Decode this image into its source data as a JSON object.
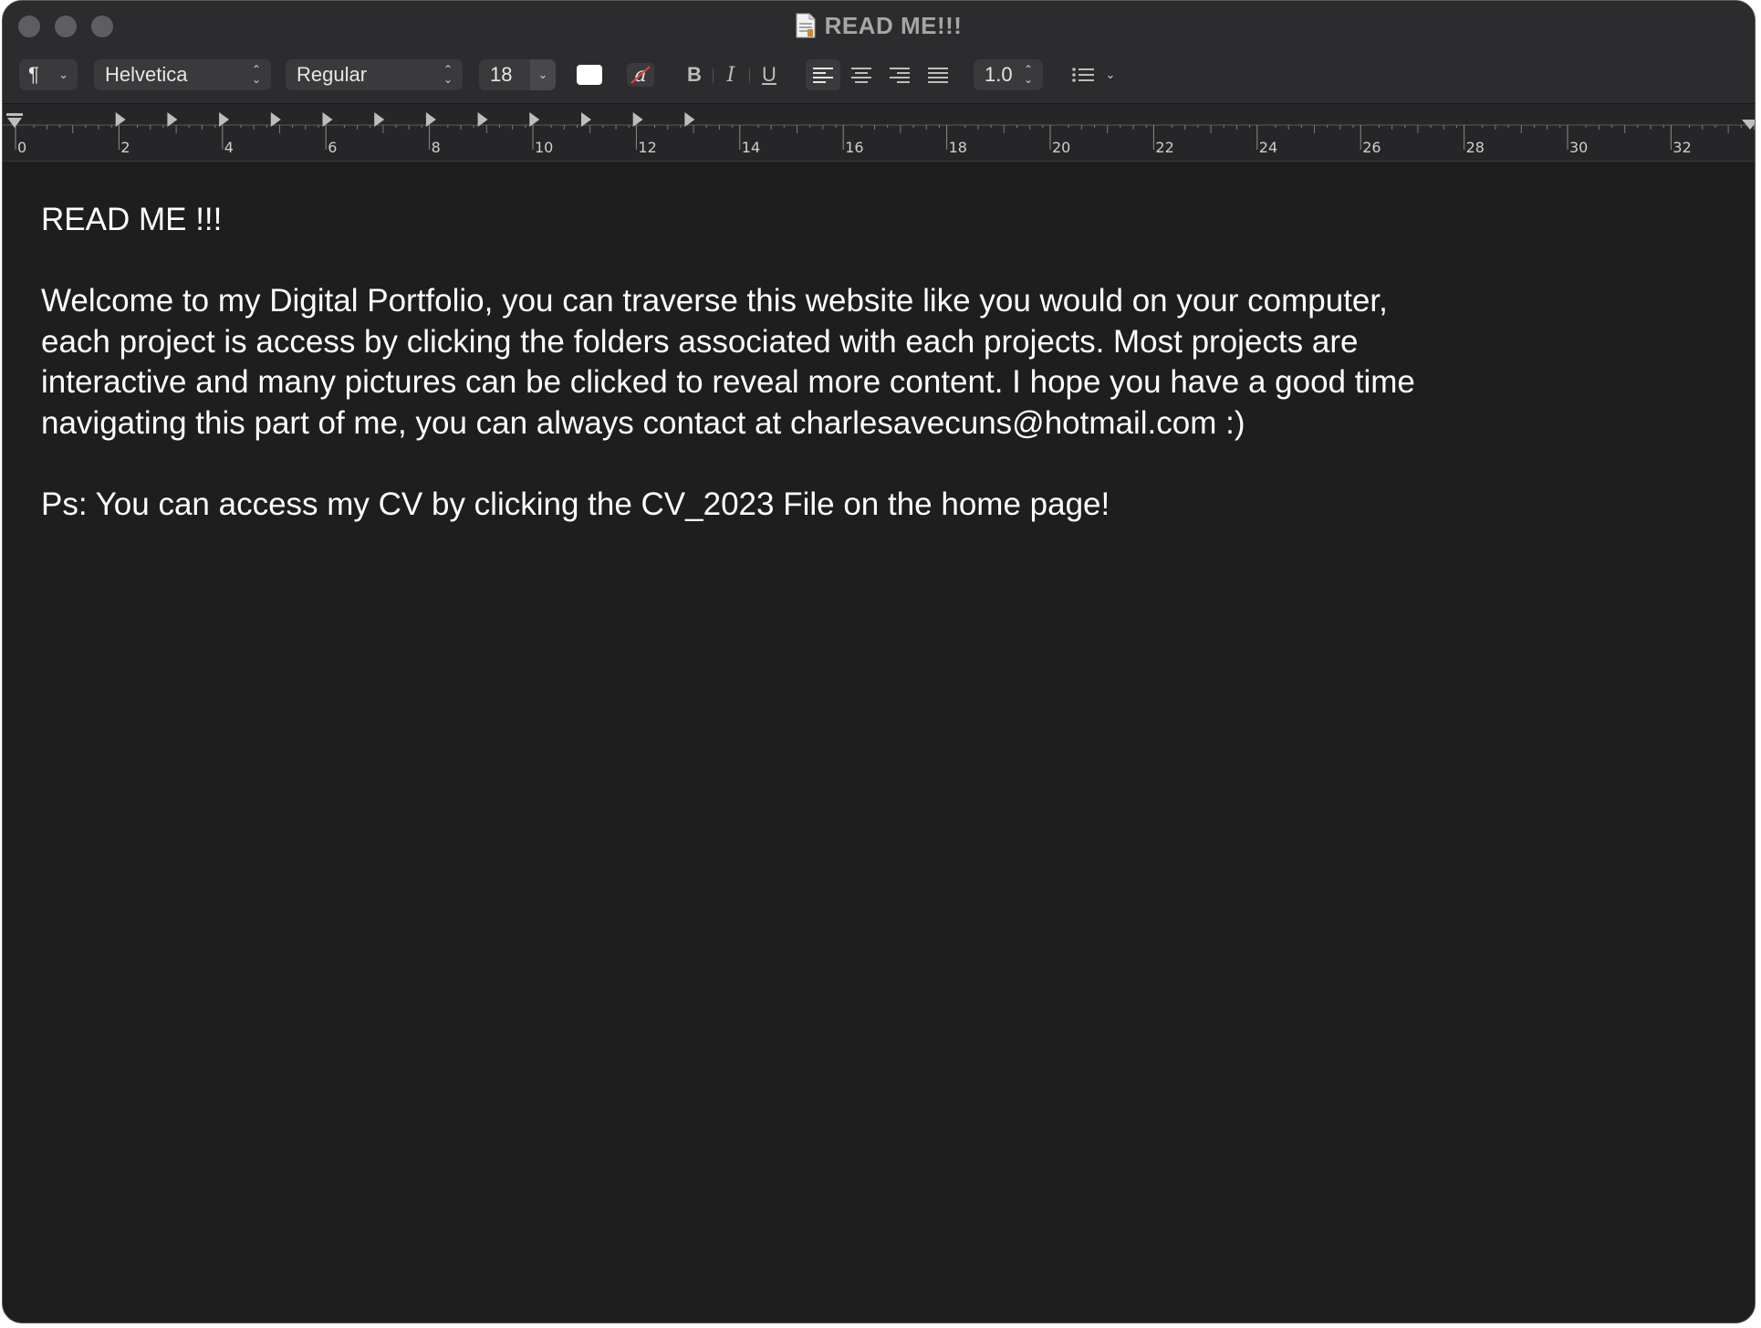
{
  "window": {
    "title": "READ ME!!!"
  },
  "toolbar": {
    "paragraph_style_icon": "¶",
    "font_family": "Helvetica",
    "font_style": "Regular",
    "font_size": "18",
    "text_color": "#ffffff",
    "highlight_icon": "a",
    "bold_label": "B",
    "italic_label": "I",
    "underline_label": "U",
    "line_spacing": "1.0",
    "active_alignment": "left"
  },
  "ruler": {
    "labels": [
      "0",
      "2",
      "4",
      "6",
      "8",
      "10",
      "12",
      "14",
      "16",
      "18",
      "20",
      "22",
      "24",
      "26",
      "28",
      "30",
      "32"
    ]
  },
  "document": {
    "heading": "READ ME !!!",
    "paragraph_lines": [
      "Welcome to my Digital Portfolio, you can traverse this website like you would on your computer,",
      "each project is access by clicking the folders associated with each projects. Most projects are",
      "interactive and many pictures can be clicked to reveal more content. I hope you have a good time",
      "navigating this part of me, you can always contact at charlesavecuns@hotmail.com :)"
    ],
    "ps": "Ps: You can access my CV by clicking the CV_2023 File on the home page!"
  },
  "colors": {
    "window_bg": "#1e1e1e",
    "toolbar_bg": "#2c2c2e",
    "control_bg": "#3a3a3c",
    "text": "#ffffff"
  }
}
